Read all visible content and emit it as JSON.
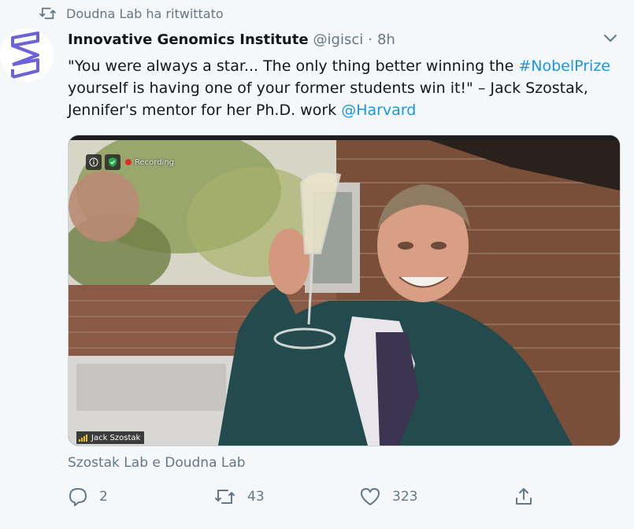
{
  "retweet_context": {
    "icon": "retweet-icon",
    "text": "Doudna Lab ha ritwittato"
  },
  "author": {
    "name": "Innovative Genomics Institute",
    "handle": "@igisci",
    "separator": "·",
    "time": "8h",
    "avatar_icon": "igi-logo-icon",
    "brand_color": "#6c63d8"
  },
  "tweet": {
    "segments": [
      {
        "text": "\"You were always a star... The only thing better winning the ",
        "type": "text"
      },
      {
        "text": "#NobelPrize",
        "type": "hashtag"
      },
      {
        "text": " yourself is having one of your former students win it!\" – Jack Szostak, Jennifer's mentor for her Ph.D. work ",
        "type": "text"
      },
      {
        "text": "@Harvard",
        "type": "mention"
      }
    ],
    "link_color": "#1b95e0"
  },
  "media": {
    "overlay": {
      "recording_label": "Recording",
      "participant_name": "Jack Szostak"
    }
  },
  "social_context": "Szostak Lab e Doudna Lab",
  "actions": {
    "reply": {
      "icon": "reply-icon",
      "count": "2"
    },
    "retweet": {
      "icon": "retweet-icon",
      "count": "43"
    },
    "like": {
      "icon": "heart-icon",
      "count": "323"
    },
    "share": {
      "icon": "share-icon"
    }
  }
}
